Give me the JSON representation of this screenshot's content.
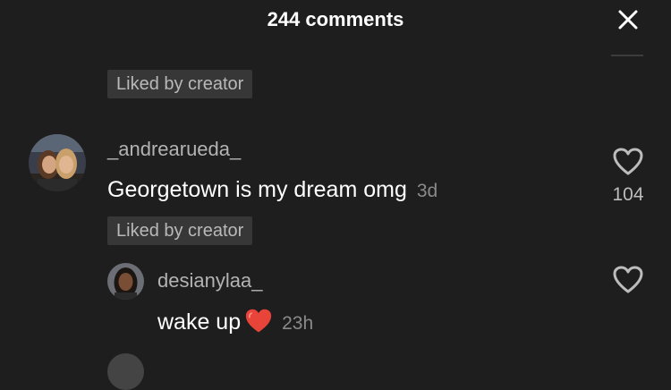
{
  "header": {
    "title": "244 comments",
    "close_icon": "close-icon"
  },
  "colors": {
    "background": "#1e1e1e",
    "badge_bg": "#373737",
    "heart_emoji": "#e8443a"
  },
  "comments": [
    {
      "liked_badge": "Liked by creator"
    },
    {
      "username": "_andrearueda_",
      "text": "Georgetown is my dream omg",
      "time": "3d",
      "like_count": "104",
      "like_icon": "heart-outline-icon",
      "liked_badge": "Liked by creator"
    }
  ],
  "replies": [
    {
      "username": "desianylaa_",
      "text": "wake up",
      "emoji_icon": "red-heart-emoji-icon",
      "time": "23h",
      "like_icon": "heart-outline-icon"
    }
  ]
}
